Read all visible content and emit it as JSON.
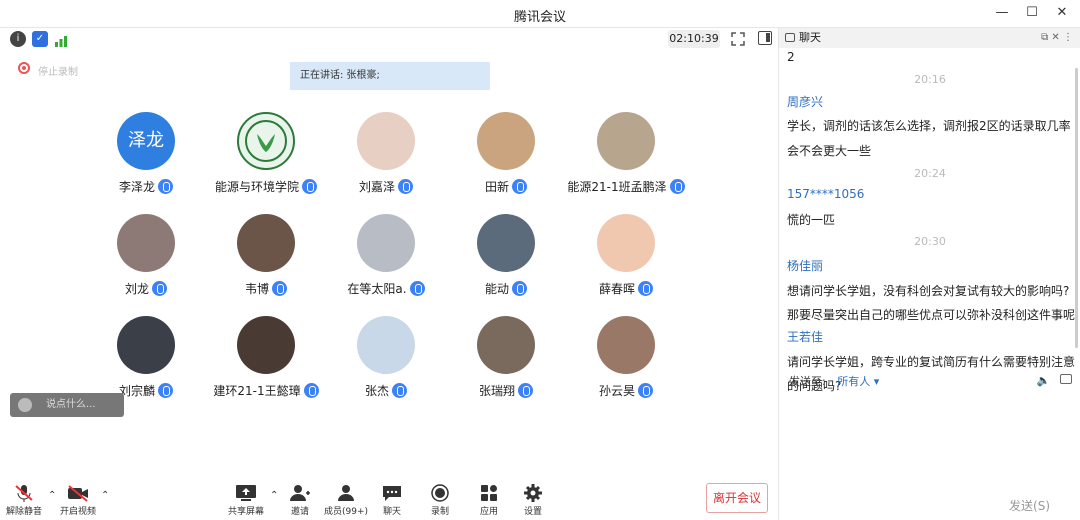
{
  "window": {
    "title": "腾讯会议",
    "controls": [
      "—",
      "☐",
      "✕"
    ]
  },
  "toolbar": {
    "timer": "02:10:39"
  },
  "recording": {
    "label": "停止录制"
  },
  "speaking": {
    "label": "正在讲话: 张根豪;"
  },
  "participants": [
    {
      "name": "李泽龙",
      "avatar_text": "泽龙",
      "avatar_color": "#2f7fe0"
    },
    {
      "name": "能源与环境学院",
      "avatar_text": "",
      "avatar_color": "#e9f4ea"
    },
    {
      "name": "刘嘉泽",
      "avatar_text": "",
      "avatar_color": "#e8cfc3"
    },
    {
      "name": "田新",
      "avatar_text": "",
      "avatar_color": "#c9a47e"
    },
    {
      "name": "能源21-1班孟鹏泽",
      "avatar_text": "",
      "avatar_color": "#b7a58e"
    },
    {
      "name": "刘龙",
      "avatar_text": "",
      "avatar_color": "#8d7a76"
    },
    {
      "name": "韦博",
      "avatar_text": "",
      "avatar_color": "#6b5448"
    },
    {
      "name": "在等太阳a.",
      "avatar_text": "",
      "avatar_color": "#b8bcc4"
    },
    {
      "name": "能动",
      "avatar_text": "",
      "avatar_color": "#5b6b7c"
    },
    {
      "name": "薛春晖",
      "avatar_text": "",
      "avatar_color": "#f0c8b0"
    },
    {
      "name": "刘宗麟",
      "avatar_text": "",
      "avatar_color": "#3a3f48"
    },
    {
      "name": "建环21-1王懿璋",
      "avatar_text": "",
      "avatar_color": "#4a3a34"
    },
    {
      "name": "张杰",
      "avatar_text": "",
      "avatar_color": "#c8d8e8"
    },
    {
      "name": "张瑞翔",
      "avatar_text": "",
      "avatar_color": "#7a6a5e"
    },
    {
      "name": "孙云昊",
      "avatar_text": "",
      "avatar_color": "#9a7868"
    }
  ],
  "say_box": {
    "label": "说点什么..."
  },
  "bottombar": {
    "unmute": "解除静音",
    "video": "开启视频",
    "share": "共享屏幕",
    "invite": "邀请",
    "members": "成员(99+)",
    "chat": "聊天",
    "record": "录制",
    "apps": "应用",
    "settings": "设置",
    "leave": "离开会议"
  },
  "chat": {
    "title": "聊天",
    "lines": [
      {
        "kind": "text",
        "text": "2"
      },
      {
        "kind": "time",
        "text": "20:16"
      },
      {
        "kind": "sender",
        "text": "周彦兴"
      },
      {
        "kind": "text",
        "text": "学长，调剂的话该怎么选择，调剂报2区的话录取几率"
      },
      {
        "kind": "text",
        "text": "会不会更大一些"
      },
      {
        "kind": "time",
        "text": "20:24"
      },
      {
        "kind": "sender",
        "text": "157****1056"
      },
      {
        "kind": "text",
        "text": "慌的一匹"
      },
      {
        "kind": "time",
        "text": "20:30"
      },
      {
        "kind": "sender",
        "text": "杨佳丽"
      },
      {
        "kind": "text",
        "text": "想请问学长学姐，没有科创会对复试有较大的影响吗?"
      },
      {
        "kind": "text",
        "text": "那要尽量突出自己的哪些优点可以弥补没科创这件事呢"
      },
      {
        "kind": "sender",
        "text": "王若佳"
      },
      {
        "kind": "text",
        "text": "请问学长学姐，跨专业的复试简历有什么需要特别注意"
      },
      {
        "kind": "text",
        "text": "的问题吗?"
      }
    ],
    "send_to_label": "发送至:",
    "send_to_value": "所有人",
    "send_button": "发送(S)"
  }
}
